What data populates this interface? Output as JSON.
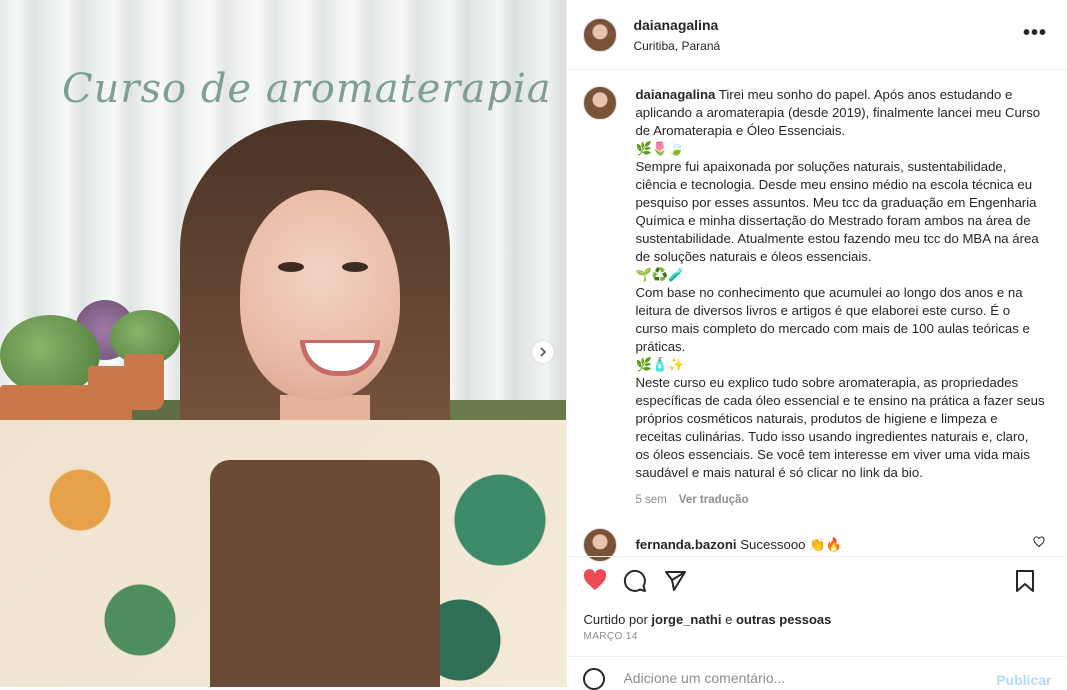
{
  "media": {
    "overlay_title": "Curso de aromaterapia",
    "next_icon": "chevron-right-icon"
  },
  "header": {
    "username": "daianagalina",
    "location": "Curitiba, Paraná",
    "more_icon": "more-horizontal-icon",
    "more_label": "•••"
  },
  "caption": {
    "username": "daianagalina",
    "paragraphs": [
      "Tirei meu sonho do papel. Após anos estudando e aplicando a aromaterapia (desde 2019), finalmente lancei meu Curso de Aromaterapia e Óleo Essenciais.",
      "🌿🌷🍃",
      "Sempre fui apaixonada por soluções naturais, sustentabilidade, ciência e tecnologia. Desde meu ensino médio na escola técnica eu pesquiso por esses assuntos. Meu tcc da graduação em Engenharia Química e minha dissertação do Mestrado foram ambos na área de sustentabilidade. Atualmente estou fazendo meu tcc do MBA na área de soluções naturais e óleos essenciais.",
      "🌱♻️🧪",
      "Com base no conhecimento que acumulei ao longo dos anos e na leitura de diversos livros e artigos é que elaborei este curso. É o curso mais completo do mercado com mais de 100 aulas teóricas e práticas.",
      "🌿🧴✨",
      "Neste curso eu explico tudo sobre aromaterapia, as propriedades específicas de cada óleo essencial e te ensino na prática a fazer seus próprios cosméticos naturais, produtos de higiene e limpeza e receitas culinárias. Tudo isso usando ingredientes naturais e, claro, os óleos essenciais. Se você tem interesse em viver uma vida mais saudável e mais natural é só clicar no link da bio."
    ],
    "time_ago": "5 sem",
    "translate_label": "Ver tradução"
  },
  "comment": {
    "username": "fernanda.bazoni",
    "text": "Sucessooo 👏🔥",
    "like_icon": "heart-outline-icon"
  },
  "actions": {
    "like_icon": "heart-filled-icon",
    "comment_icon": "comment-icon",
    "share_icon": "send-icon",
    "save_icon": "bookmark-icon",
    "like_color": "#ed4956"
  },
  "likes": {
    "prefix": "Curtido por",
    "user": "jorge_nathi",
    "connector": "e",
    "others": "outras pessoas"
  },
  "post_date": "MARÇO 14",
  "add_comment": {
    "placeholder": "Adicione um comentário...",
    "publish_label": "Publicar",
    "emoji_icon": "smiley-icon"
  }
}
